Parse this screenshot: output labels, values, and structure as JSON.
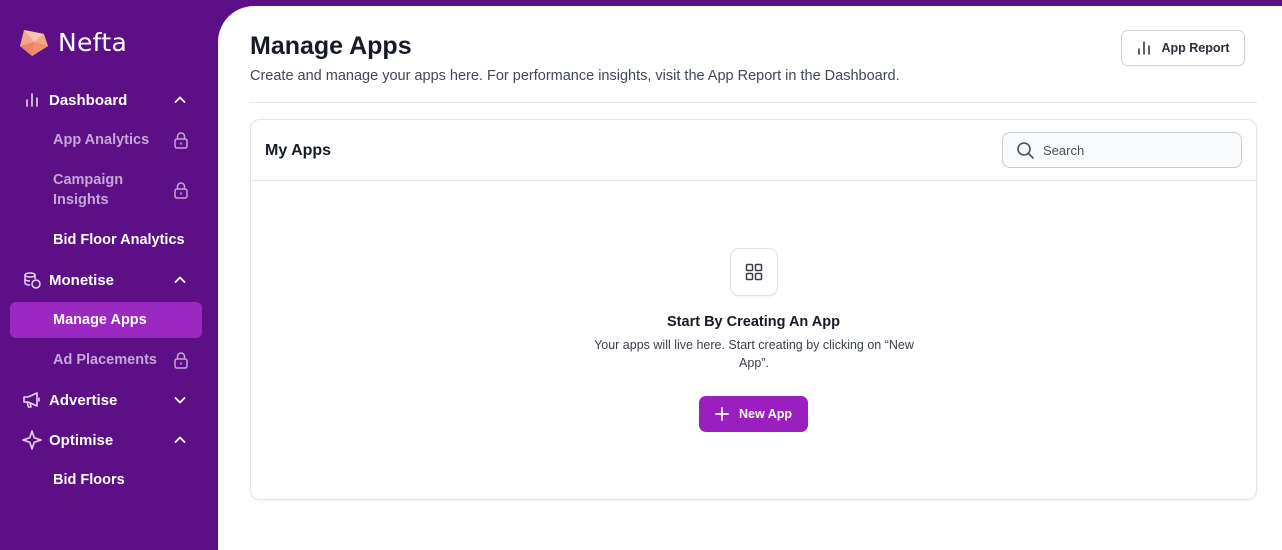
{
  "brand": {
    "name": "Nefta"
  },
  "sidebar": {
    "dashboard": {
      "label": "Dashboard",
      "icon": "bar-chart-icon",
      "expanded": true
    },
    "dashboard_items": [
      {
        "label": "App Analytics",
        "locked": true
      },
      {
        "label": "Campaign Insights",
        "locked": true
      },
      {
        "label": "Bid Floor Analytics",
        "locked": false
      }
    ],
    "monetise": {
      "label": "Monetise",
      "icon": "coins-icon",
      "expanded": true
    },
    "monetise_items": [
      {
        "label": "Manage Apps",
        "active": true
      },
      {
        "label": "Ad Placements",
        "locked": true
      }
    ],
    "advertise": {
      "label": "Advertise",
      "icon": "megaphone-icon",
      "expanded": false
    },
    "optimise": {
      "label": "Optimise",
      "icon": "sparkle-icon",
      "expanded": true
    },
    "optimise_items": [
      {
        "label": "Bid Floors",
        "locked": false
      }
    ]
  },
  "header": {
    "title": "Manage Apps",
    "subtitle": "Create and manage your apps here. For performance insights, visit the App Report in the Dashboard.",
    "report_button": "App Report"
  },
  "apps_card": {
    "title": "My Apps",
    "search_placeholder": "Search",
    "empty_title": "Start By Creating An App",
    "empty_text": "Your apps will live here. Start creating by clicking on “New App”.",
    "new_button": "New App"
  },
  "colors": {
    "sidebar_bg": "#5d0f86",
    "active_item_bg": "#9b28c0",
    "primary_button": "#9b1fbe",
    "locked_text": "#c5a6d7"
  }
}
